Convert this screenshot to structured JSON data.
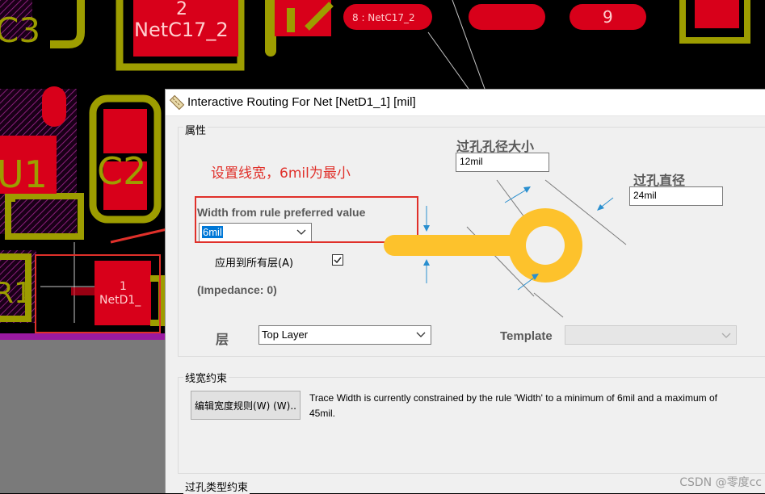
{
  "pcb": {
    "labels": {
      "c3": "C3",
      "pin2_num": "2",
      "netc17_big": "NetC17_2",
      "pad8": "8 : NetC17_2",
      "pad9": "9",
      "u1": "U1",
      "c2": "C2",
      "r1": "R1",
      "netd1_num": "1",
      "netd1_name": "NetD1_"
    }
  },
  "dialog": {
    "title": "Interactive Routing For Net [NetD1_1] [mil]",
    "properties": {
      "group_label": "属性",
      "annotation": "设置线宽，6mil为最小",
      "width_label": "Width from rule preferred value",
      "width_value": "6mil",
      "apply_all_label": "应用到所有层(A)",
      "apply_all_checked": true,
      "impedance": "(Impedance: 0)",
      "via_hole_size_label": "过孔孔径大小",
      "via_hole_size_value": "12mil",
      "via_diameter_label": "过孔直径",
      "via_diameter_value": "24mil",
      "layer_label": "层",
      "layer_value": "Top Layer",
      "template_label": "Template",
      "template_value": ""
    },
    "width_constraint": {
      "group_label": "线宽约束",
      "edit_button": "编辑宽度规则(W) (W)..",
      "description": "Trace Width is currently constrained by the rule 'Width' to a minimum of 6mil and a maximum of 45mil."
    },
    "via_type_group_label": "过孔类型约束"
  },
  "colors": {
    "pad_red": "#d8001a",
    "silk_yellow": "#9d9d00",
    "trace_gold": "#fdc22c",
    "annotation_red": "#e0302a"
  },
  "watermark": "CSDN @零度cc"
}
